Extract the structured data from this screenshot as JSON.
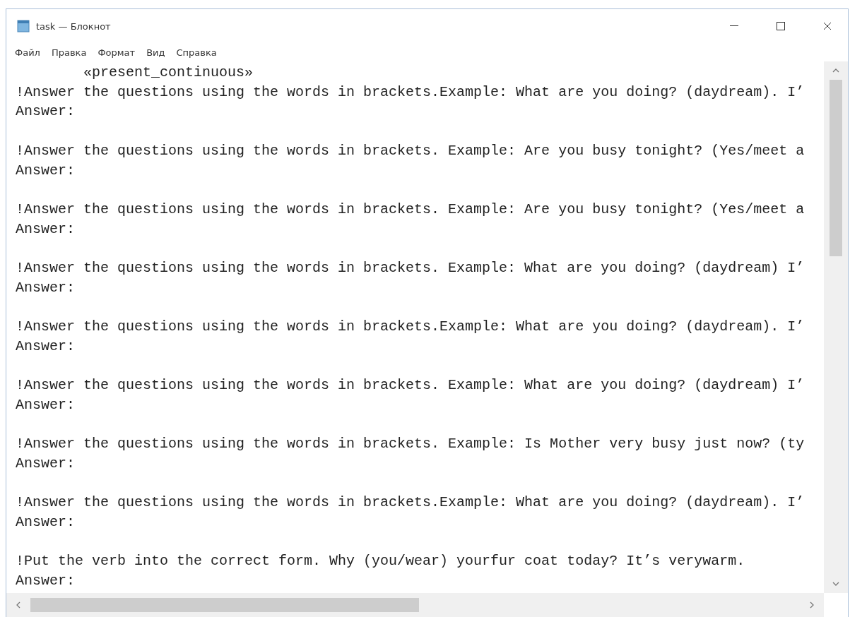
{
  "window": {
    "title": "task — Блокнот"
  },
  "menu": [
    "Файл",
    "Правка",
    "Формат",
    "Вид",
    "Справка"
  ],
  "document": {
    "heading": "«present_continuous»",
    "tasks": [
      {
        "question": "!Answer the questions using the words in brackets.Example: What are you doing? (daydream). I’",
        "answer": "Answer:"
      },
      {
        "question": "!Answer the questions using the words in brackets. Example: Are you busy tonight? (Yes/meet a",
        "answer": "Answer:"
      },
      {
        "question": "!Answer the questions using the words in brackets. Example: Are you busy tonight? (Yes/meet a",
        "answer": "Answer:"
      },
      {
        "question": "!Answer the questions using the words in brackets. Example: What are you doing? (daydream) I’",
        "answer": "Answer:"
      },
      {
        "question": "!Answer the questions using the words in brackets.Example: What are you doing? (daydream). I’",
        "answer": "Answer:"
      },
      {
        "question": "!Answer the questions using the words in brackets. Example: What are you doing? (daydream) I’",
        "answer": "Answer:"
      },
      {
        "question": "!Answer the questions using the words in brackets. Example: Is Mother very busy just now? (ty",
        "answer": "Answer:"
      },
      {
        "question": "!Answer the questions using the words in brackets.Example: What are you doing? (daydream). I’",
        "answer": "Answer:"
      },
      {
        "question": "!Put the verb into the correct form. Why (you/wear) yourfur coat today? It’s verywarm.",
        "answer": "Answer:"
      }
    ]
  }
}
